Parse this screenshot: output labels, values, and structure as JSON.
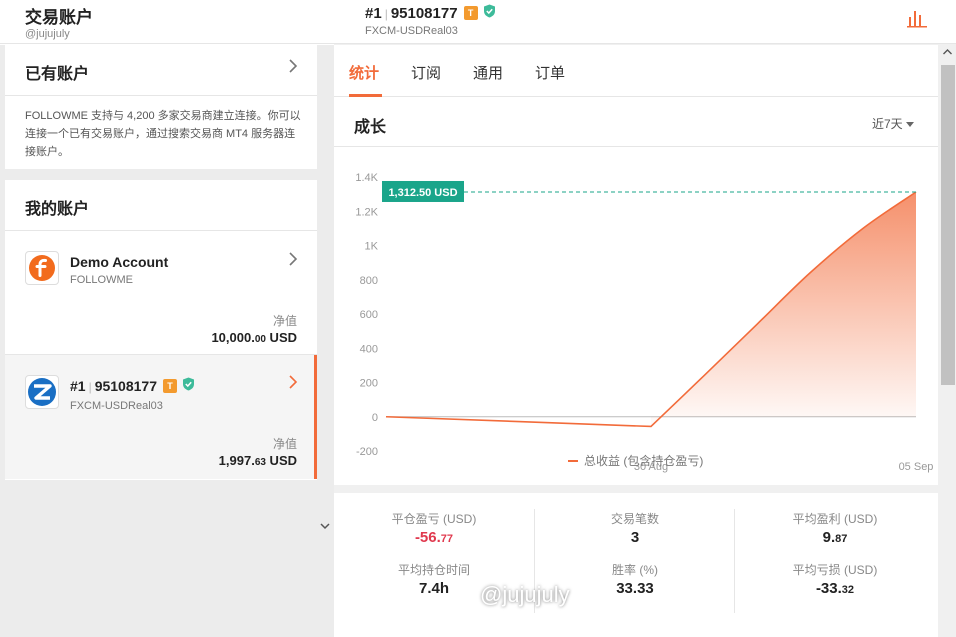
{
  "app": {
    "title": "交易账户",
    "handle": "@jujujuly"
  },
  "existing": {
    "title": "已有账户",
    "description": "FOLLOWME 支持与 4,200 多家交易商建立连接。你可以连接一个已有交易账户，通过搜索交易商 MT4 服务器连接账户。"
  },
  "my_accounts": {
    "title": "我的账户",
    "accounts": [
      {
        "name": "Demo Account",
        "broker": "FOLLOWME",
        "equity_label": "净值",
        "equity_main": "10,000.",
        "equity_dec": "00",
        "equity_unit": " USD",
        "logo": "followme-logo"
      },
      {
        "number": "#1",
        "id": "95108177",
        "badge": "T",
        "server": "FXCM-USDReal03",
        "equity_label": "净值",
        "equity_main": "1,997.",
        "equity_dec": "63",
        "equity_unit": " USD",
        "logo": "fxcm-logo"
      }
    ]
  },
  "header": {
    "number": "#1",
    "id": "95108177",
    "badge": "T",
    "server": "FXCM-USDReal03"
  },
  "tabs": [
    "统计",
    "订阅",
    "通用",
    "订单"
  ],
  "growth": {
    "title": "成长",
    "range": "近7天"
  },
  "chart_data": {
    "type": "area",
    "y_ticks": [
      "1.4K",
      "1.2K",
      "1K",
      "800",
      "600",
      "400",
      "200",
      "0",
      "-200"
    ],
    "ylim": [
      -200,
      1400
    ],
    "x_ticks": [
      "30 Aug",
      "05 Sep"
    ],
    "series": [
      {
        "name": "总收益 (包含持仓盈亏)",
        "x": [
          0,
          0.25,
          0.5,
          0.6,
          0.7,
          0.8,
          0.9,
          1.0
        ],
        "values": [
          0,
          -28,
          -56.77,
          240,
          540,
          840,
          1100,
          1312.5
        ]
      }
    ],
    "current_label": "1,312.50 USD",
    "current_value": 1312.5,
    "colors": {
      "line": "#f26b3a",
      "label_bg": "#1aa58a"
    }
  },
  "stats": [
    {
      "label": "平仓盈亏 (USD)",
      "main": "-56.",
      "dec": "77",
      "neg": true
    },
    {
      "label": "交易笔数",
      "main": "3",
      "dec": "",
      "neg": false
    },
    {
      "label": "平均盈利 (USD)",
      "main": "9.",
      "dec": "87",
      "neg": false
    },
    {
      "label": "平均持仓时间",
      "main": "7.4h",
      "dec": "",
      "neg": false
    },
    {
      "label": "胜率 (%)",
      "main": "33.33",
      "dec": "",
      "neg": false
    },
    {
      "label": "平均亏损 (USD)",
      "main": "-33.",
      "dec": "32",
      "neg": false
    }
  ],
  "watermark": "@jujujuly"
}
